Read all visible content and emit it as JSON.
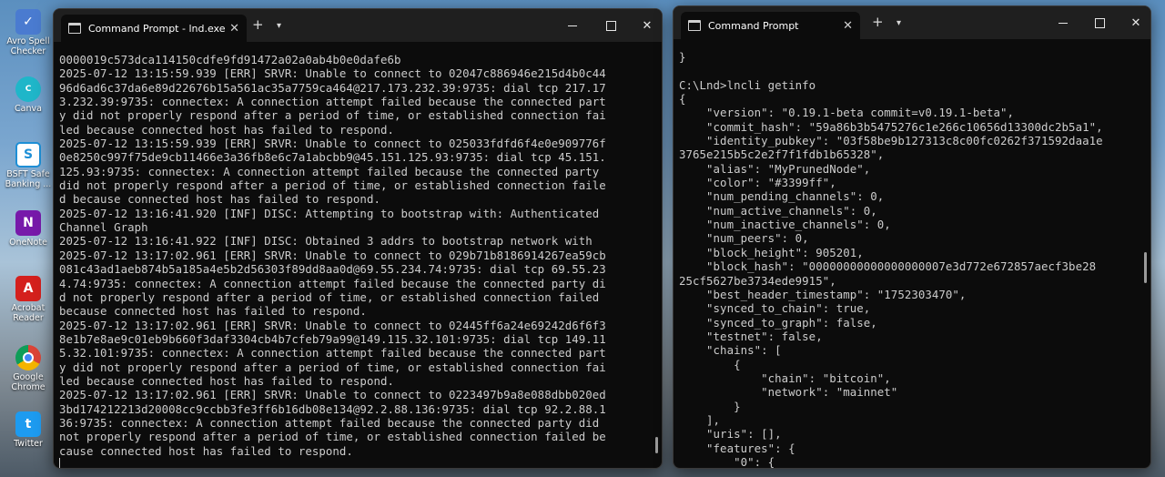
{
  "desktop": {
    "icons": [
      {
        "label": "Avro Spell Checker",
        "icon": "avro-spell-checker-icon",
        "color": "#4a7bd0"
      },
      {
        "label": "Canva",
        "icon": "canva-icon",
        "color": "#1fb6c9"
      },
      {
        "label": "BSFT Safe Banking ...",
        "icon": "safe-banking-icon",
        "color": "#1e8fd6"
      },
      {
        "label": "OneNote",
        "icon": "onenote-icon",
        "color": "#7719aa"
      },
      {
        "label": "Acrobat Reader",
        "icon": "acrobat-icon",
        "color": "#d4201d"
      },
      {
        "label": "Google Chrome",
        "icon": "chrome-icon",
        "color": "#e8e8e8"
      },
      {
        "label": "Twitter",
        "icon": "twitter-icon",
        "color": "#1d9bf0"
      }
    ]
  },
  "left_window": {
    "tab_title": "Command Prompt - lnd.exe",
    "lines": [
      "0000019c573dca114150cdfe9fd91472a02a0ab4b0e0dafe6b",
      "2025-07-12 13:15:59.939 [ERR] SRVR: Unable to connect to 02047c886946e215d4b0c44",
      "96d6ad6c37da6e89d22676b15a561ac35a7759ca464@217.173.232.39:9735: dial tcp 217.17",
      "3.232.39:9735: connectex: A connection attempt failed because the connected part",
      "y did not properly respond after a period of time, or established connection fai",
      "led because connected host has failed to respond.",
      "2025-07-12 13:15:59.939 [ERR] SRVR: Unable to connect to 025033fdfd6f4e0e909776f",
      "0e8250c997f75de9cb11466e3a36fb8e6c7a1abcbb9@45.151.125.93:9735: dial tcp 45.151.",
      "125.93:9735: connectex: A connection attempt failed because the connected party",
      "did not properly respond after a period of time, or established connection faile",
      "d because connected host has failed to respond.",
      "2025-07-12 13:16:41.920 [INF] DISC: Attempting to bootstrap with: Authenticated",
      "Channel Graph",
      "2025-07-12 13:16:41.922 [INF] DISC: Obtained 3 addrs to bootstrap network with",
      "2025-07-12 13:17:02.961 [ERR] SRVR: Unable to connect to 029b71b8186914267ea59cb",
      "081c43ad1aeb874b5a185a4e5b2d56303f89dd8aa0d@69.55.234.74:9735: dial tcp 69.55.23",
      "4.74:9735: connectex: A connection attempt failed because the connected party di",
      "d not properly respond after a period of time, or established connection failed",
      "because connected host has failed to respond.",
      "2025-07-12 13:17:02.961 [ERR] SRVR: Unable to connect to 02445ff6a24e69242d6f6f3",
      "8e1b7e8ae9c01eb9b660f3daf3304cb4b7cfeb79a99@149.115.32.101:9735: dial tcp 149.11",
      "5.32.101:9735: connectex: A connection attempt failed because the connected part",
      "y did not properly respond after a period of time, or established connection fai",
      "led because connected host has failed to respond.",
      "2025-07-12 13:17:02.961 [ERR] SRVR: Unable to connect to 0223497b9a8e088dbb020ed",
      "3bd174212213d20008cc9ccbb3fe3ff6b16db08e134@92.2.88.136:9735: dial tcp 92.2.88.1",
      "36:9735: connectex: A connection attempt failed because the connected party did",
      "not properly respond after a period of time, or established connection failed be",
      "cause connected host has failed to respond."
    ]
  },
  "right_window": {
    "tab_title": "Command Prompt",
    "lines": [
      "}",
      "",
      "C:\\Lnd>lncli getinfo",
      "{",
      "    \"version\": \"0.19.1-beta commit=v0.19.1-beta\",",
      "    \"commit_hash\": \"59a86b3b5475276c1e266c10656d13300dc2b5a1\",",
      "    \"identity_pubkey\": \"03f58be9b127313c8c00fc0262f371592daa1e",
      "3765e215b5c2e2f7f1fdb1b65328\",",
      "    \"alias\": \"MyPrunedNode\",",
      "    \"color\": \"#3399ff\",",
      "    \"num_pending_channels\": 0,",
      "    \"num_active_channels\": 0,",
      "    \"num_inactive_channels\": 0,",
      "    \"num_peers\": 0,",
      "    \"block_height\": 905201,",
      "    \"block_hash\": \"00000000000000000007e3d772e672857aecf3be28",
      "25cf5627be3734ede9915\",",
      "    \"best_header_timestamp\": \"1752303470\",",
      "    \"synced_to_chain\": true,",
      "    \"synced_to_graph\": false,",
      "    \"testnet\": false,",
      "    \"chains\": [",
      "        {",
      "            \"chain\": \"bitcoin\",",
      "            \"network\": \"mainnet\"",
      "        }",
      "    ],",
      "    \"uris\": [],",
      "    \"features\": {",
      "        \"0\": {"
    ]
  },
  "controls": {
    "new_tab": "+",
    "dropdown": "⌄",
    "close": "✕",
    "tab_close": "✕"
  }
}
